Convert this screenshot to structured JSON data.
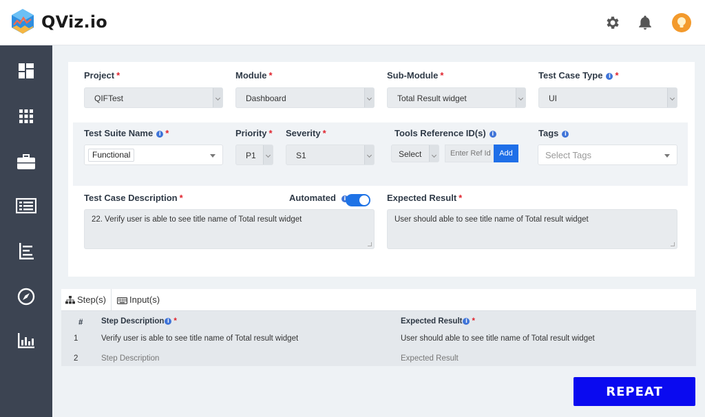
{
  "app": {
    "brand": "QViz.io"
  },
  "colors": {
    "accent": "#1f6fe8",
    "sidebar": "#3c4452",
    "required": "#e0232d",
    "repeat_button": "#0a0af0"
  },
  "sidebar": {
    "items": [
      {
        "icon": "dashboard-icon"
      },
      {
        "icon": "apps-grid-icon"
      },
      {
        "icon": "briefcase-icon"
      },
      {
        "icon": "list-icon"
      },
      {
        "icon": "tree-icon"
      },
      {
        "icon": "compass-icon"
      },
      {
        "icon": "bar-chart-icon"
      }
    ]
  },
  "form": {
    "project": {
      "label": "Project",
      "value": "QIFTest"
    },
    "module": {
      "label": "Module",
      "value": "Dashboard"
    },
    "submodule": {
      "label": "Sub-Module",
      "value": "Total Result widget"
    },
    "case_type": {
      "label": "Test Case Type",
      "value": "UI"
    },
    "suite": {
      "label": "Test Suite Name",
      "value": "Functional"
    },
    "priority": {
      "label": "Priority",
      "value": "P1"
    },
    "severity": {
      "label": "Severity",
      "value": "S1"
    },
    "tools_ref": {
      "label": "Tools Reference ID(s)",
      "select_value": "Select",
      "input_placeholder": "Enter Ref Id",
      "add_label": "Add"
    },
    "tags": {
      "label": "Tags",
      "placeholder": "Select Tags"
    },
    "description": {
      "label": "Test Case Description",
      "value": "22. Verify user is able to see title name of Total result widget"
    },
    "automated": {
      "label": "Automated",
      "on": true
    },
    "expected": {
      "label": "Expected Result",
      "value": "User should able to see title name of Total result widget"
    }
  },
  "steps": {
    "tabs": [
      {
        "label": "Step(s)"
      },
      {
        "label": "Input(s)"
      }
    ],
    "headers": {
      "num": "#",
      "desc": "Step Description",
      "expected": "Expected Result"
    },
    "rows": [
      {
        "num": "1",
        "desc": "Verify user is able to see title name of Total result widget",
        "expected": "User should able to see title name of Total result widget"
      },
      {
        "num": "2",
        "desc": "Step Description",
        "expected": "Expected Result"
      }
    ]
  },
  "actions": {
    "repeat_label": "REPEAT"
  }
}
